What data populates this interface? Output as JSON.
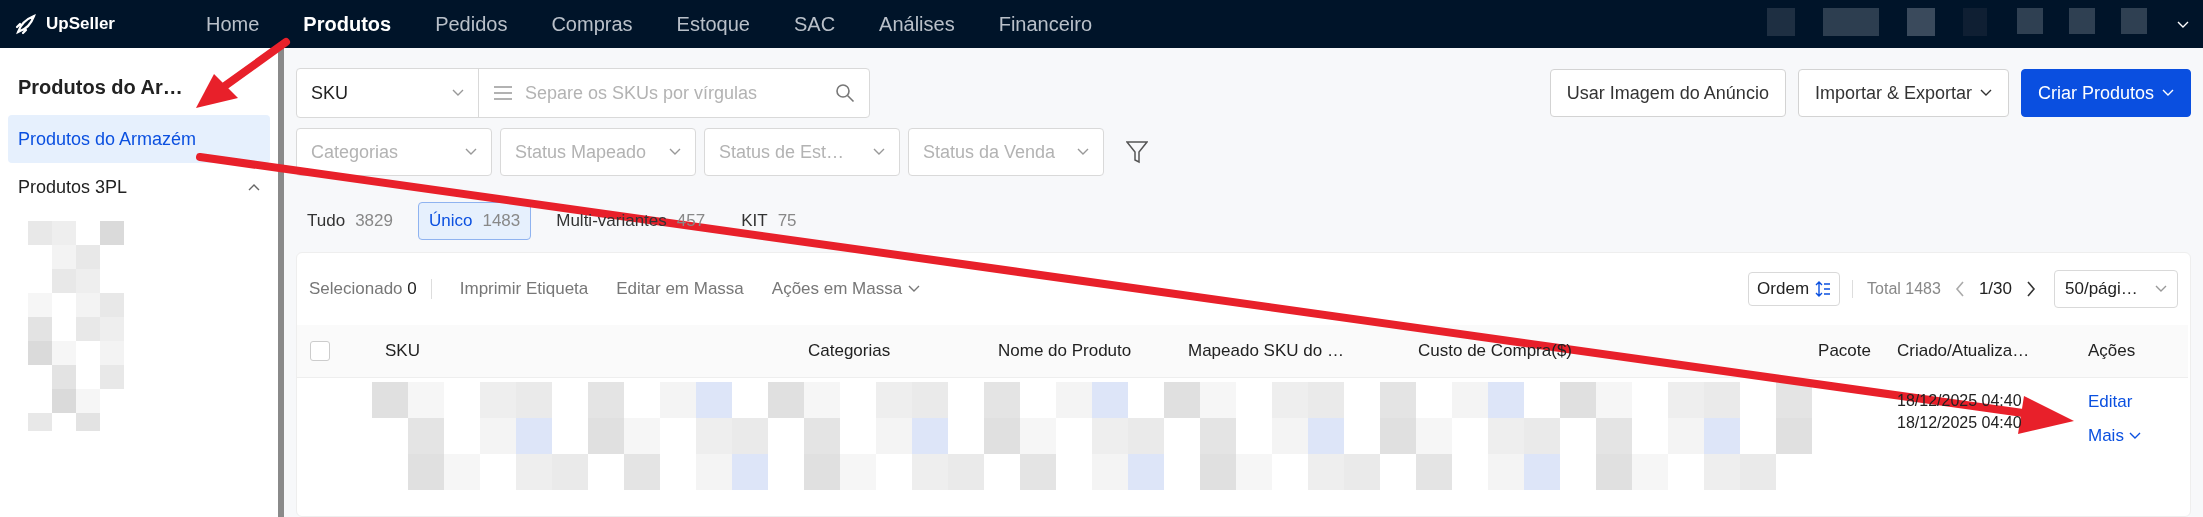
{
  "nav": {
    "logo": "UpSeller",
    "items": [
      {
        "label": "Home",
        "selected": false
      },
      {
        "label": "Produtos",
        "selected": true
      },
      {
        "label": "Pedidos",
        "selected": false
      },
      {
        "label": "Compras",
        "selected": false
      },
      {
        "label": "Estoque",
        "selected": false
      },
      {
        "label": "SAC",
        "selected": false
      },
      {
        "label": "Análises",
        "selected": false
      },
      {
        "label": "Financeiro",
        "selected": false
      }
    ]
  },
  "sidebar": {
    "title": "Produtos do Ar…",
    "items": [
      {
        "label": "Produtos do Armazém",
        "selected": true,
        "kind": "link"
      },
      {
        "label": "Produtos 3PL",
        "selected": false,
        "kind": "group",
        "expanded": true
      }
    ]
  },
  "search": {
    "field": "SKU",
    "placeholder": "Separe os SKUs por vírgulas"
  },
  "filters": [
    {
      "placeholder": "Categorias"
    },
    {
      "placeholder": "Status Mapeado"
    },
    {
      "placeholder": "Status de Est…"
    },
    {
      "placeholder": "Status da Venda"
    }
  ],
  "actions": [
    {
      "label": "Usar Imagem do Anúncio",
      "kind": "default",
      "dropdown": false
    },
    {
      "label": "Importar & Exportar",
      "kind": "default",
      "dropdown": true
    },
    {
      "label": "Criar Produtos",
      "kind": "primary",
      "dropdown": true
    }
  ],
  "type_tabs": [
    {
      "label": "Tudo",
      "count": "3829",
      "selected": false
    },
    {
      "label": "Único",
      "count": "1483",
      "selected": true
    },
    {
      "label": "Multi-variantes",
      "count": "457",
      "selected": false
    },
    {
      "label": "KIT",
      "count": "75",
      "selected": false
    }
  ],
  "toolbar": {
    "selected_label": "Selecionado",
    "selected_count": "0",
    "buttons": [
      {
        "label": "Imprimir Etiqueta",
        "dropdown": false
      },
      {
        "label": "Editar em Massa",
        "dropdown": false
      },
      {
        "label": "Ações em Massa",
        "dropdown": true
      }
    ],
    "sort": "Ordem",
    "total": "Total 1483",
    "page": "1/30",
    "page_size": "50/pági…"
  },
  "table": {
    "select_all_checked": false,
    "columns": [
      "SKU",
      "Categorias",
      "Nome do Produto",
      "Mapeado SKU do …",
      "Custo de Compra($)",
      "Pacote",
      "Criado/Atualiza…",
      "Ações"
    ],
    "rows": [
      {
        "created": "18/12/2025 04:40",
        "updated": "18/12/2025 04:40",
        "actions": [
          "Editar",
          "Mais"
        ]
      }
    ]
  }
}
